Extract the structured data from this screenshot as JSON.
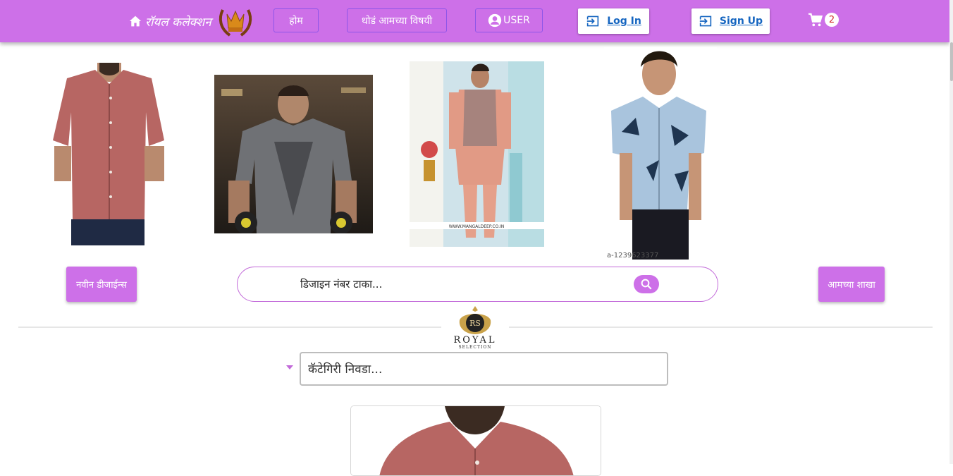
{
  "navbar": {
    "brand": "रॉयल कलेक्शन",
    "home_button": "होम",
    "about_button": "थोडं आमच्या विषयी",
    "user_button": "USER",
    "login_button": "Log In",
    "signup_button": "Sign Up",
    "cart_count": "2",
    "bg_color": "#cd70e8"
  },
  "products": [
    {
      "icon": "maroon-shirt-photo"
    },
    {
      "icon": "grey-gym-tshirt-photo"
    },
    {
      "icon": "peach-kurta-jacket-photo",
      "caption": "WWW.MANGALDEEP.CO.IN"
    },
    {
      "icon": "blue-printed-shirt-photo",
      "caption": "a-1239623377"
    }
  ],
  "new_designs_button": "नवीन डीजाईन्स",
  "search": {
    "placeholder": "डिजाइन नंबर टाका..."
  },
  "branches_button": "आमच्या शाखा",
  "logo": {
    "monogram": "RS",
    "word": "ROYAL",
    "sub": "SELECTION"
  },
  "category": {
    "placeholder": "कॅटेगिरी निवडा..."
  }
}
